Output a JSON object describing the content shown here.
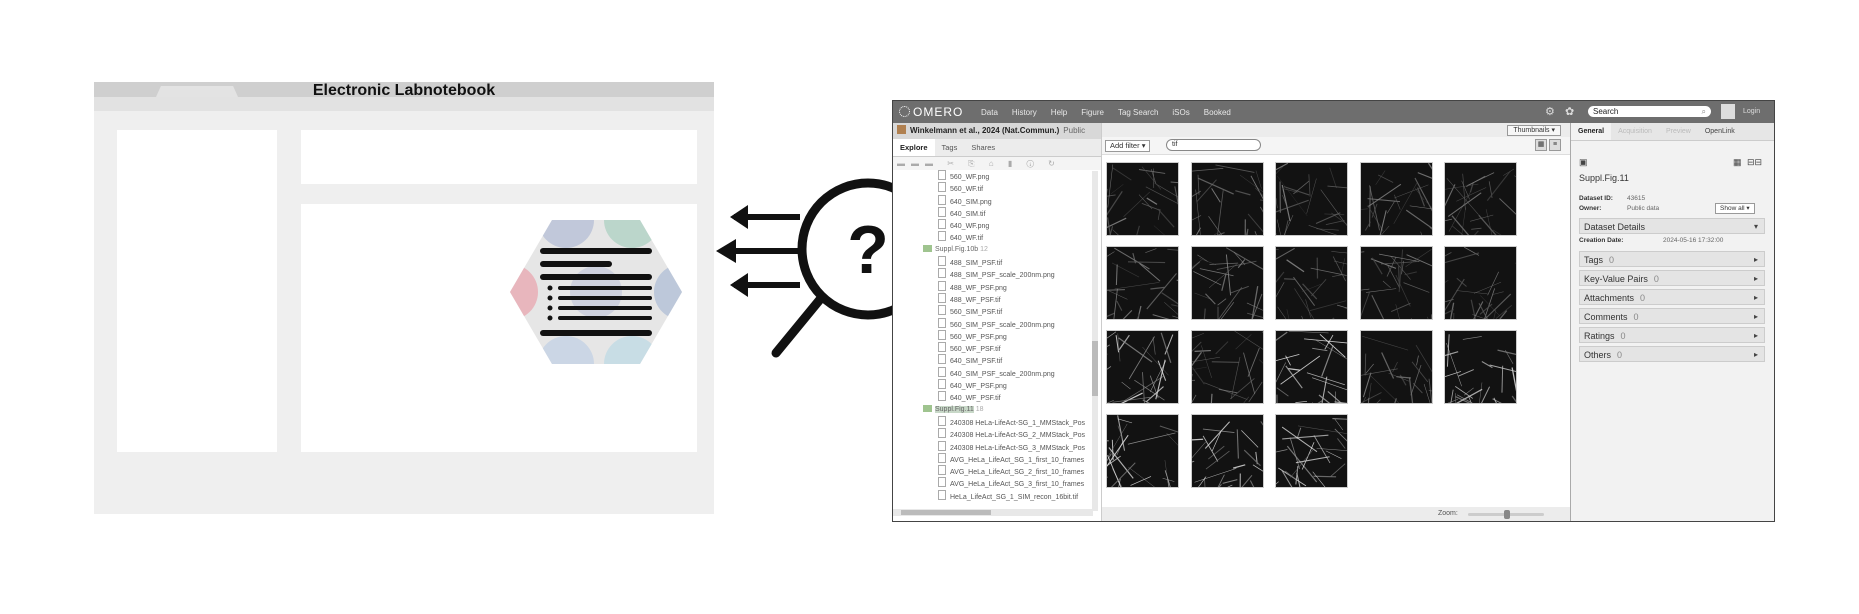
{
  "eln": {
    "title": "Electronic Labnotebook"
  },
  "magnifier": {
    "symbol": "?"
  },
  "omero": {
    "logo": "OMERO",
    "menu": [
      "Data",
      "History",
      "Help",
      "Figure",
      "Tag Search",
      "iSOs",
      "Booked"
    ],
    "search_placeholder": "Search",
    "login": "Login",
    "group_title": "Winkelmann et al., 2024 (Nat.Commun.)",
    "group_privacy": "Public",
    "left_tabs": [
      "Explore",
      "Tags",
      "Shares"
    ],
    "tree": [
      {
        "type": "file",
        "label": "560_WF.png"
      },
      {
        "type": "file",
        "label": "560_WF.tif"
      },
      {
        "type": "file",
        "label": "640_SIM.png"
      },
      {
        "type": "file",
        "label": "640_SIM.tif"
      },
      {
        "type": "file",
        "label": "640_WF.png"
      },
      {
        "type": "file",
        "label": "640_WF.tif"
      },
      {
        "type": "dataset",
        "label": "Suppl.Fig.10b",
        "count": "12"
      },
      {
        "type": "file",
        "label": "488_SIM_PSF.tif"
      },
      {
        "type": "file",
        "label": "488_SIM_PSF_scale_200nm.png"
      },
      {
        "type": "file",
        "label": "488_WF_PSF.png"
      },
      {
        "type": "file",
        "label": "488_WF_PSF.tif"
      },
      {
        "type": "file",
        "label": "560_SIM_PSF.tif"
      },
      {
        "type": "file",
        "label": "560_SIM_PSF_scale_200nm.png"
      },
      {
        "type": "file",
        "label": "560_WF_PSF.png"
      },
      {
        "type": "file",
        "label": "560_WF_PSF.tif"
      },
      {
        "type": "file",
        "label": "640_SIM_PSF.tif"
      },
      {
        "type": "file",
        "label": "640_SIM_PSF_scale_200nm.png"
      },
      {
        "type": "file",
        "label": "640_WF_PSF.png"
      },
      {
        "type": "file",
        "label": "640_WF_PSF.tif"
      },
      {
        "type": "dataset",
        "label": "Suppl.Fig.11",
        "count": "18",
        "selected": true
      },
      {
        "type": "file",
        "label": "240308 HeLa-LifeAct-SG_1_MMStack_Pos"
      },
      {
        "type": "file",
        "label": "240308 HeLa-LifeAct-SG_2_MMStack_Pos"
      },
      {
        "type": "file",
        "label": "240308 HeLa-LifeAct-SG_3_MMStack_Pos"
      },
      {
        "type": "file",
        "label": "AVG_HeLa_LifeAct_SG_1_first_10_frames"
      },
      {
        "type": "file",
        "label": "AVG_HeLa_LifeAct_SG_2_first_10_frames"
      },
      {
        "type": "file",
        "label": "AVG_HeLa_LifeAct_SG_3_first_10_frames"
      },
      {
        "type": "file",
        "label": "HeLa_LifeAct_SG_1_SIM_recon_16bit.tif"
      }
    ],
    "view_mode": "Thumbnails",
    "add_filter": "Add filter",
    "filter_value": "tif",
    "zoom_label": "Zoom:",
    "thumbnail_count": 18,
    "right_tabs": [
      "General",
      "Acquisition",
      "Preview",
      "OpenLink"
    ],
    "dataset_name": "Suppl.Fig.11",
    "dataset_id_label": "Dataset ID:",
    "dataset_id": "43615",
    "owner_label": "Owner:",
    "owner": "Public data",
    "show_all": "Show all",
    "details_section": "Dataset Details",
    "creation_label": "Creation Date:",
    "creation_date": "2024-05-16 17:32:00",
    "sections": [
      {
        "label": "Tags",
        "count": "0"
      },
      {
        "label": "Key-Value Pairs",
        "count": "0"
      },
      {
        "label": "Attachments",
        "count": "0"
      },
      {
        "label": "Comments",
        "count": "0"
      },
      {
        "label": "Ratings",
        "count": "0"
      },
      {
        "label": "Others",
        "count": "0"
      }
    ]
  }
}
